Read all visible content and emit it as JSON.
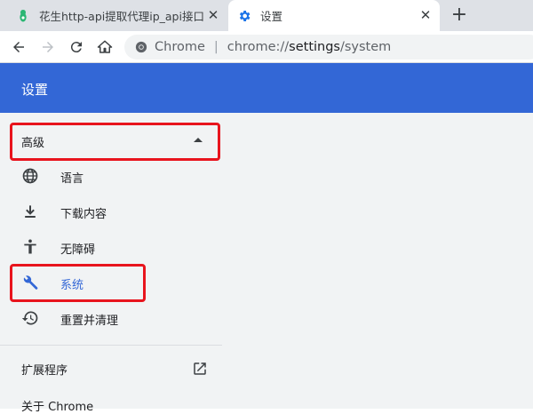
{
  "tabs": [
    {
      "title": "花生http-api提取代理ip_api接口",
      "icon": "peanut-favicon",
      "active": false
    },
    {
      "title": "设置",
      "icon": "gear-icon",
      "active": true
    }
  ],
  "toolbar": {
    "site_chip": "Chrome",
    "url_prefix": "chrome://",
    "url_host": "settings",
    "url_path": "/system"
  },
  "header": {
    "title": "设置"
  },
  "sidebar": {
    "advanced_label": "高级",
    "items": [
      {
        "label": "语言",
        "icon": "globe-icon",
        "selected": false
      },
      {
        "label": "下载内容",
        "icon": "download-icon",
        "selected": false
      },
      {
        "label": "无障碍",
        "icon": "accessibility-icon",
        "selected": false
      },
      {
        "label": "系统",
        "icon": "wrench-icon",
        "selected": true
      },
      {
        "label": "重置并清理",
        "icon": "restore-icon",
        "selected": false
      }
    ],
    "extensions_label": "扩展程序",
    "about_label": "关于 Chrome"
  },
  "colors": {
    "header_bg": "#3367d6",
    "accent": "#3367d6",
    "highlight_box": "#e8141d",
    "content_bg": "#f1f3f4"
  }
}
